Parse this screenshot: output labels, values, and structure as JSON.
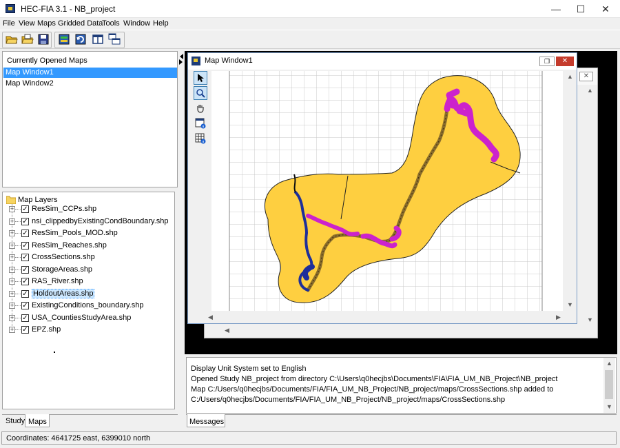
{
  "window": {
    "title": "HEC-FIA 3.1 - NB_project",
    "minimize": "—",
    "maximize": "☐",
    "close": "✕"
  },
  "menu": [
    "File",
    "View",
    "Maps",
    "Gridded Data",
    "Tools",
    "Window",
    "Help"
  ],
  "toolbar_icons": [
    "open-folder-icon",
    "open-project-icon",
    "save-icon",
    "map-layers-icon",
    "map-refresh-icon",
    "tile-windows-icon",
    "cascade-windows-icon"
  ],
  "maps_panel": {
    "header": "Currently Opened Maps",
    "items": [
      "Map Window1",
      "Map Window2"
    ],
    "selected_index": 0
  },
  "layers_panel": {
    "root": "Map Layers",
    "layers": [
      {
        "name": "ResSim_CCPs.shp",
        "checked": true
      },
      {
        "name": "nsi_clippedbyExistingCondBoundary.shp",
        "checked": true
      },
      {
        "name": "ResSim_Pools_MOD.shp",
        "checked": true
      },
      {
        "name": "ResSim_Reaches.shp",
        "checked": true
      },
      {
        "name": "CrossSections.shp",
        "checked": true
      },
      {
        "name": "StorageAreas.shp",
        "checked": true
      },
      {
        "name": "RAS_River.shp",
        "checked": true
      },
      {
        "name": "HoldoutAreas.shp",
        "checked": true,
        "highlighted": true
      },
      {
        "name": "ExistingConditions_boundary.shp",
        "checked": true
      },
      {
        "name": "USA_CountiesStudyArea.shp",
        "checked": true
      },
      {
        "name": "EPZ.shp",
        "checked": true
      }
    ]
  },
  "left_tabs": [
    "Study",
    "Maps"
  ],
  "map_window": {
    "title": "Map Window1",
    "tools": [
      "select-arrow-icon",
      "zoom-icon",
      "pan-hand-icon",
      "identify-icon",
      "grid-table-icon"
    ],
    "colors": {
      "boundary": "#fecf40",
      "pools": "#cc22cc",
      "river": "#8a6d2a",
      "holdout": "#1e2f9a"
    }
  },
  "messages": {
    "tab": "Messages",
    "lines": [
      "Display Unit System set to English",
      "Opened Study NB_project from directory C:\\Users\\q0hecjbs\\Documents\\FIA\\FIA_UM_NB_Project\\NB_project",
      "Map C:/Users/q0hecjbs/Documents/FIA/FIA_UM_NB_Project/NB_project/maps/CrossSections.shp added to",
      "C:/Users/q0hecjbs/Documents/FIA/FIA_UM_NB_Project/NB_project/maps/CrossSections.shp"
    ]
  },
  "status": {
    "coordinates": "Coordinates: 4641725 east, 6399010 north"
  }
}
